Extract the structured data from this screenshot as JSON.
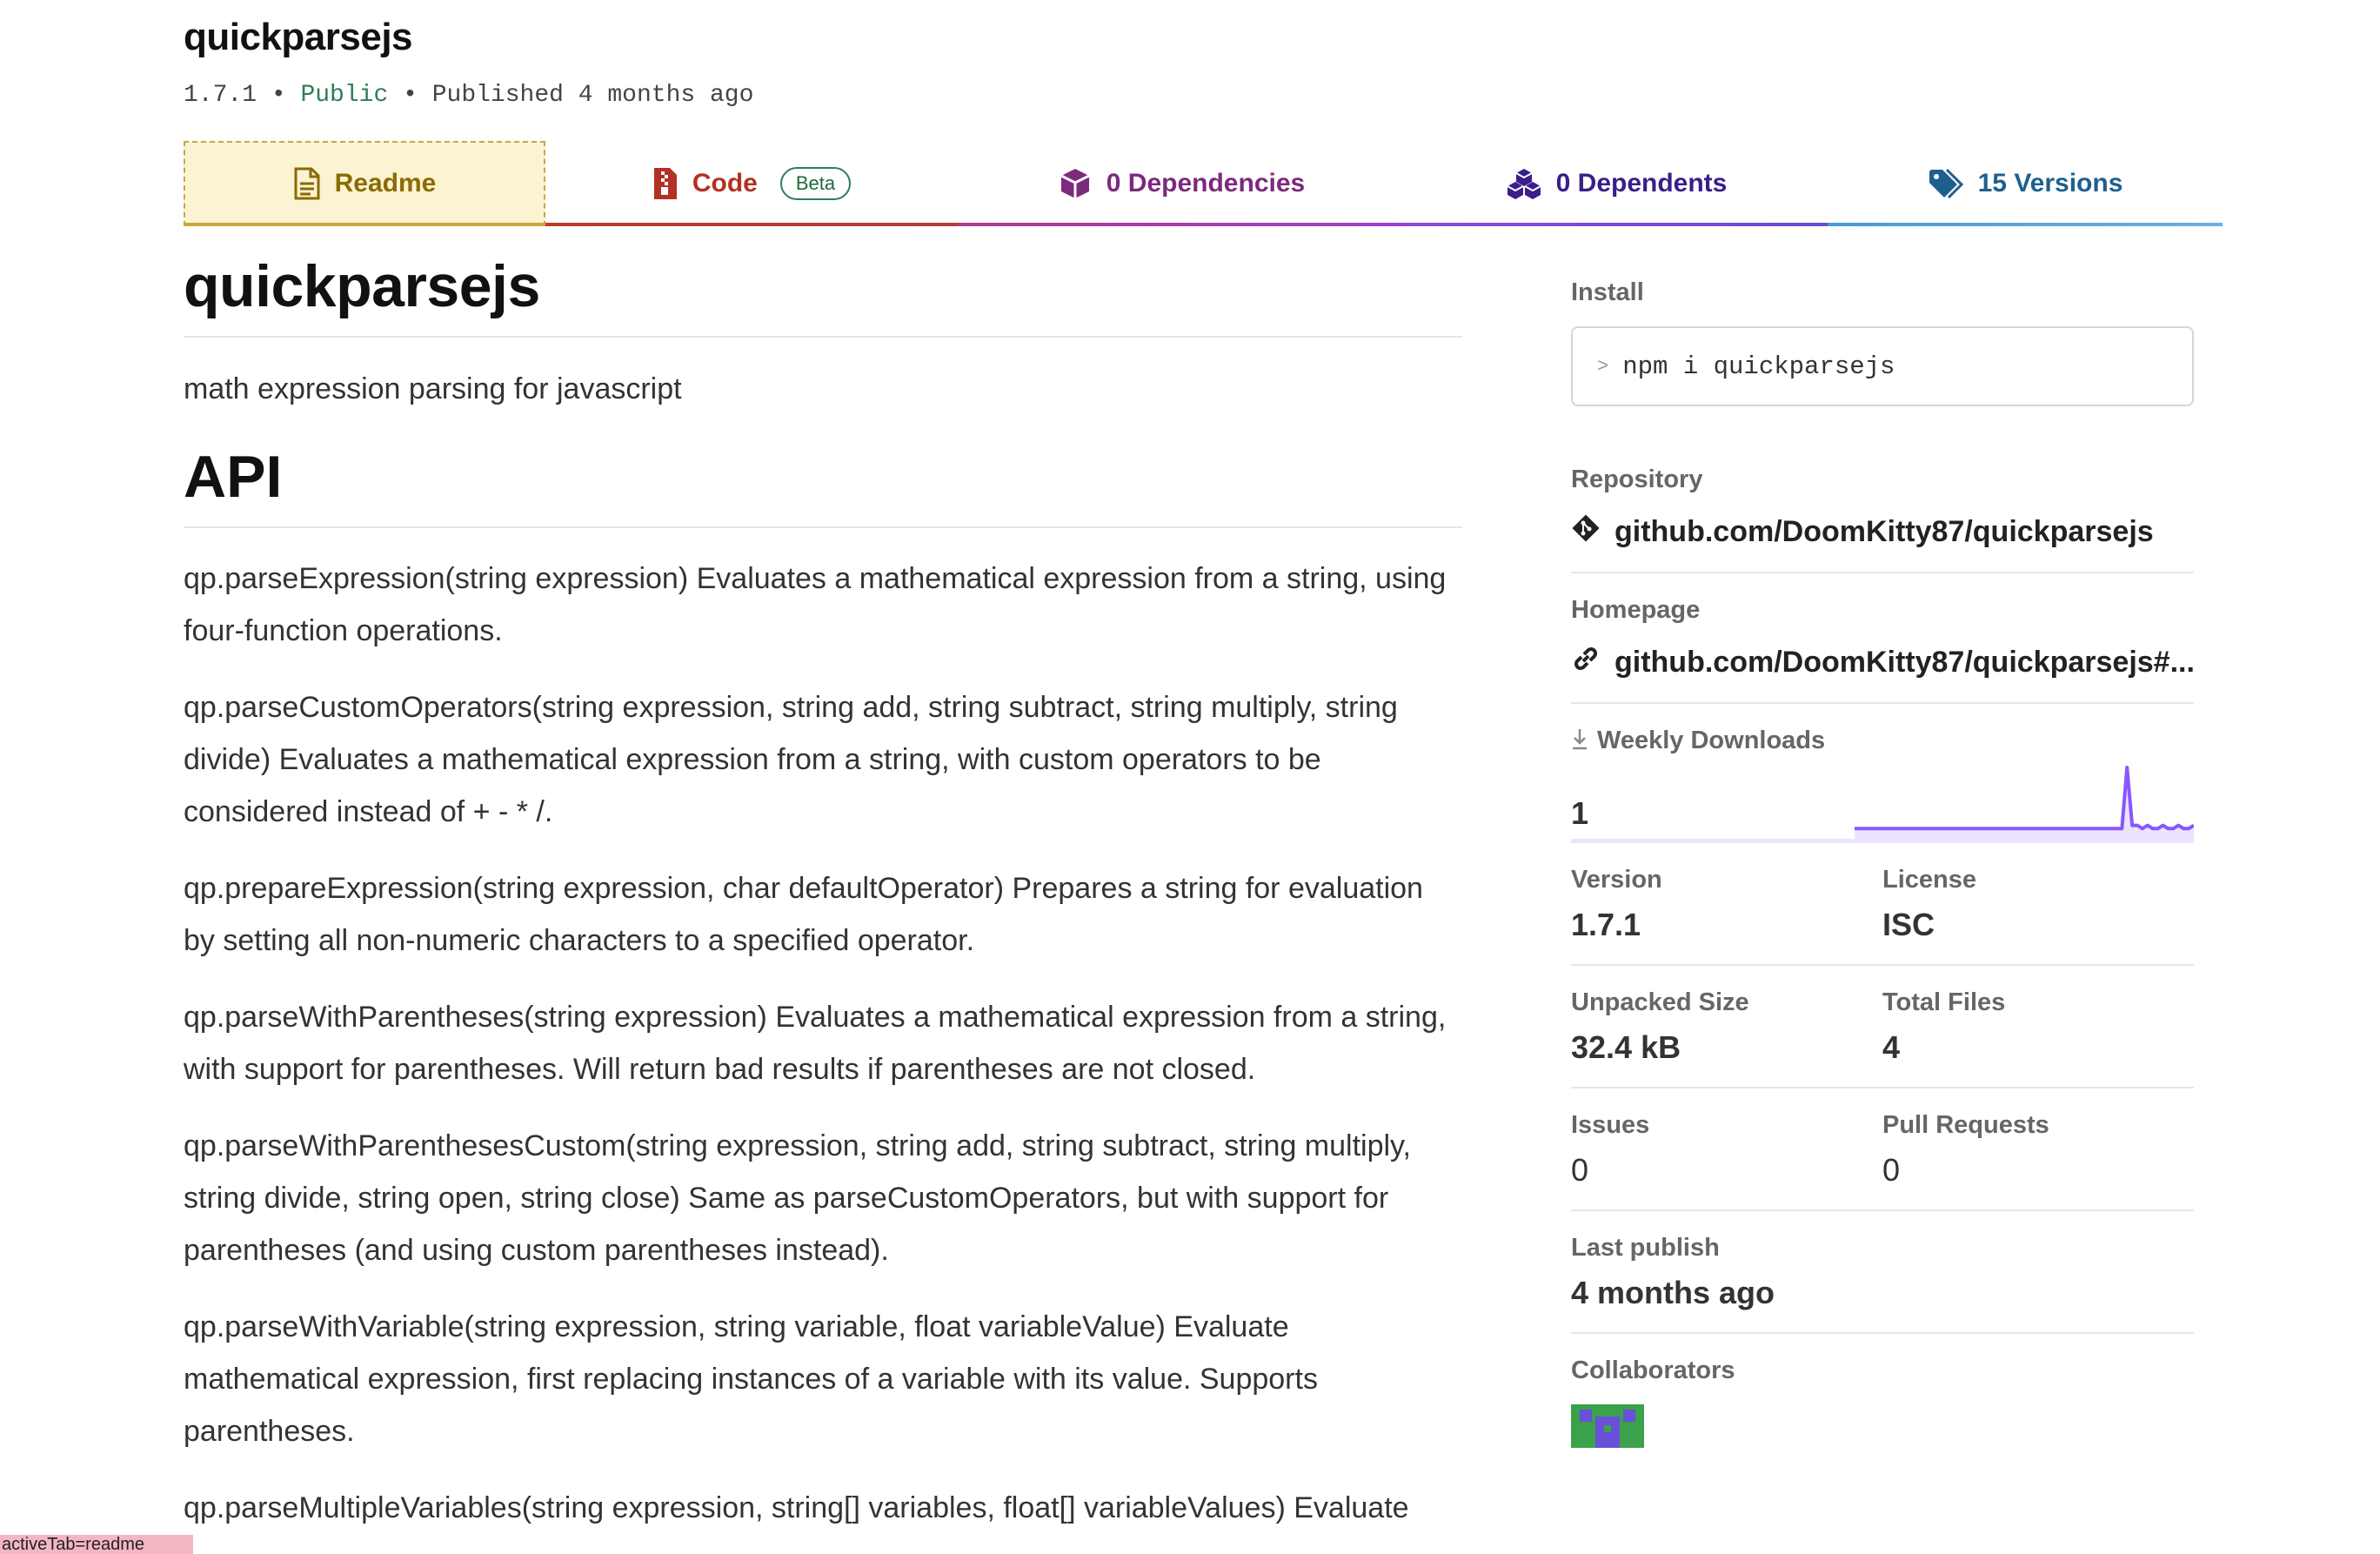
{
  "package": {
    "name": "quickparsejs",
    "version": "1.7.1",
    "visibility": "Public",
    "published": "Published 4 months ago",
    "separator": "•"
  },
  "tabs": [
    {
      "label": "Readme",
      "icon": "document-icon",
      "active": true
    },
    {
      "label": "Code",
      "icon": "zip-file-icon",
      "badge": "Beta"
    },
    {
      "label": "0 Dependencies",
      "icon": "package-box-icon"
    },
    {
      "label": "0 Dependents",
      "icon": "stacked-boxes-icon"
    },
    {
      "label": "15 Versions",
      "icon": "tags-icon"
    }
  ],
  "readme": {
    "title": "quickparsejs",
    "description": "math expression parsing for javascript",
    "api_heading": "API",
    "paragraphs": [
      "qp.parseExpression(string expression) Evaluates a mathematical expression from a string, using four-function operations.",
      "qp.parseCustomOperators(string expression, string add, string subtract, string multiply, string divide) Evaluates a mathematical expression from a string, with custom operators to be considered instead of + - * /.",
      "qp.prepareExpression(string expression, char defaultOperator) Prepares a string for evaluation by setting all non-numeric characters to a specified operator.",
      "qp.parseWithParentheses(string expression) Evaluates a mathematical expression from a string, with support for parentheses. Will return bad results if parentheses are not closed.",
      "qp.parseWithParenthesesCustom(string expression, string add, string subtract, string multiply, string divide, string open, string close) Same as parseCustomOperators, but with support for parentheses (and using custom parentheses instead).",
      "qp.parseWithVariable(string expression, string variable, float variableValue) Evaluate mathematical expression, first replacing instances of a variable with its value. Supports parentheses.",
      "qp.parseMultipleVariables(string expression, string[] variables, float[] variableValues) Evaluate"
    ]
  },
  "sidebar": {
    "install": {
      "label": "Install",
      "command": "npm i quickparsejs",
      "prompt_icon": "terminal-prompt-icon"
    },
    "repository": {
      "label": "Repository",
      "url": "github.com/DoomKitty87/quickparsejs",
      "icon": "git-icon"
    },
    "homepage": {
      "label": "Homepage",
      "url": "github.com/DoomKitty87/quickparsejs#...",
      "icon": "link-icon"
    },
    "weekly_downloads": {
      "label": "Weekly Downloads",
      "value": "1",
      "icon": "download-icon",
      "sparkline": [
        0.05,
        0.05,
        0.05,
        0.05,
        0.05,
        0.05,
        0.05,
        0.05,
        0.05,
        0.05,
        0.05,
        0.05,
        0.05,
        0.05,
        0.05,
        0.05,
        0.05,
        0.05,
        0.05,
        0.05,
        0.05,
        0.05,
        0.05,
        0.05,
        0.05,
        0.05,
        0.05,
        0.05,
        0.05,
        0.05,
        0.05,
        0.05,
        0.05,
        0.05,
        0.05,
        0.05,
        0.05,
        0.05,
        0.05,
        0.05,
        0.05,
        0.05,
        0.05,
        0.05,
        0.05,
        0.05,
        0.05,
        0.05,
        0.05,
        0.05,
        0.05,
        0.05,
        0.05,
        1.0,
        0.1,
        0.1,
        0.05,
        0.1,
        0.05,
        0.05,
        0.1,
        0.05,
        0.05,
        0.1,
        0.05,
        0.05,
        0.1
      ],
      "accent": "#8956ff"
    },
    "version": {
      "label": "Version",
      "value": "1.7.1"
    },
    "license": {
      "label": "License",
      "value": "ISC"
    },
    "unpacked_size": {
      "label": "Unpacked Size",
      "value": "32.4 kB"
    },
    "total_files": {
      "label": "Total Files",
      "value": "4"
    },
    "issues": {
      "label": "Issues",
      "value": "0"
    },
    "pull_requests": {
      "label": "Pull Requests",
      "value": "0"
    },
    "last_publish": {
      "label": "Last publish",
      "value": "4 months ago"
    },
    "collaborators": {
      "label": "Collaborators"
    }
  },
  "debug_badge": "activeTab=readme"
}
